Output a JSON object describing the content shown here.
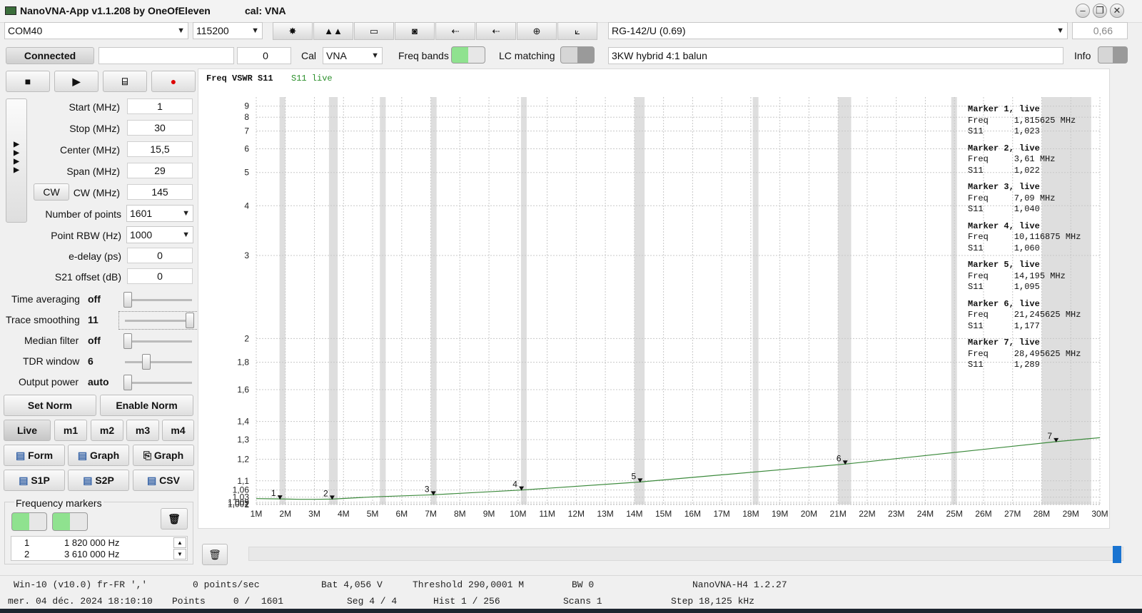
{
  "window": {
    "title": "NanoVNA-App v1.1.208 by OneOfEleven",
    "cal": "cal: VNA",
    "btn_min": "–",
    "btn_max": "❐",
    "btn_close": "✕"
  },
  "toolbar": {
    "port": "COM40",
    "baud": "115200",
    "cable": "RG-142/U (0.69)",
    "velocity": "0,66",
    "icons": [
      "settings-icon",
      "signal-icon",
      "battery-icon",
      "camera-icon",
      "usb-icon",
      "usb-plug-icon",
      "smith-chart-icon",
      "graph-icon"
    ]
  },
  "row2": {
    "connected": "Connected",
    "progress_value": "0",
    "cal_label": "Cal",
    "cal_value": "VNA",
    "freq_bands": "Freq bands",
    "lc_matching": "LC matching",
    "note": "3KW hybrid 4:1 balun",
    "info": "Info"
  },
  "controls": {
    "start_label": "Start (MHz)",
    "start": "1",
    "stop_label": "Stop (MHz)",
    "stop": "30",
    "center_label": "Center (MHz)",
    "center": "15,5",
    "span_label": "Span (MHz)",
    "span": "29",
    "cw_button": "CW",
    "cw_label": "CW (MHz)",
    "cw": "145",
    "points_label": "Number of points",
    "points": "1601",
    "rbw_label": "Point RBW (Hz)",
    "rbw": "1000",
    "edelay_label": "e-delay (ps)",
    "edelay": "0",
    "s21_label": "S21 offset (dB)",
    "s21": "0",
    "avg_label": "Time averaging",
    "avg": "off",
    "smooth_label": "Trace smoothing",
    "smooth": "11",
    "median_label": "Median filter",
    "median": "off",
    "tdr_label": "TDR window",
    "tdr": "6",
    "power_label": "Output power",
    "power": "auto",
    "set_norm": "Set Norm",
    "enable_norm": "Enable Norm",
    "live": "Live",
    "m1": "m1",
    "m2": "m2",
    "m3": "m3",
    "m4": "m4",
    "form": "Form",
    "graph1": "Graph",
    "graph2": "Graph",
    "s1p": "S1P",
    "s2p": "S2P",
    "csv": "CSV",
    "freq_markers": "Frequency markers",
    "marker_rows": [
      {
        "idx": "1",
        "freq": "1 820 000 Hz"
      },
      {
        "idx": "2",
        "freq": "3 610 000 Hz"
      }
    ]
  },
  "chart_header": {
    "title": "Freq VSWR S11",
    "live": "S11 live"
  },
  "chart_data": {
    "type": "line",
    "xlabel": "",
    "ylabel": "",
    "xlim": [
      1,
      30
    ],
    "ylim": [
      1,
      10
    ],
    "yscale": "vswr",
    "grid": true,
    "x_ticks": [
      "1M",
      "2M",
      "3M",
      "4M",
      "5M",
      "6M",
      "7M",
      "8M",
      "9M",
      "10M",
      "11M",
      "12M",
      "13M",
      "14M",
      "15M",
      "16M",
      "17M",
      "18M",
      "19M",
      "20M",
      "21M",
      "22M",
      "23M",
      "24M",
      "25M",
      "26M",
      "27M",
      "28M",
      "29M",
      "30M"
    ],
    "y_ticks": [
      {
        "v": 1,
        "label": "1"
      },
      {
        "v": 1.002,
        "label": "1,002"
      },
      {
        "v": 1.009,
        "label": "1,009"
      },
      {
        "v": 1.03,
        "label": "1,03"
      },
      {
        "v": 1.06,
        "label": "1,06"
      },
      {
        "v": 1.1,
        "label": "1,1"
      },
      {
        "v": 1.2,
        "label": "1,2"
      },
      {
        "v": 1.3,
        "label": "1,3"
      },
      {
        "v": 1.4,
        "label": "1,4"
      },
      {
        "v": 1.6,
        "label": "1,6"
      },
      {
        "v": 1.8,
        "label": "1,8"
      },
      {
        "v": 2,
        "label": "2"
      },
      {
        "v": 3,
        "label": "3"
      },
      {
        "v": 4,
        "label": "4"
      },
      {
        "v": 5,
        "label": "5"
      },
      {
        "v": 6,
        "label": "6"
      },
      {
        "v": 7,
        "label": "7"
      },
      {
        "v": 8,
        "label": "8"
      },
      {
        "v": 9,
        "label": "9"
      }
    ],
    "bands_mhz": [
      [
        1.8,
        2.0
      ],
      [
        3.5,
        3.8
      ],
      [
        5.25,
        5.45
      ],
      [
        7.0,
        7.2
      ],
      [
        10.1,
        10.15
      ],
      [
        14.0,
        14.35
      ],
      [
        18.068,
        18.168
      ],
      [
        21.0,
        21.45
      ],
      [
        24.89,
        24.99
      ],
      [
        28.0,
        29.7
      ]
    ],
    "series": [
      {
        "color": "#3c8a3c",
        "x": [
          1,
          1.815625,
          2.5,
          3.0,
          3.61,
          5,
          7.09,
          10.116875,
          14.195,
          21.245625,
          28.495625,
          30
        ],
        "y": [
          1.024,
          1.023,
          1.021,
          1.021,
          1.022,
          1.031,
          1.04,
          1.06,
          1.095,
          1.177,
          1.289,
          1.31
        ]
      }
    ],
    "markers": [
      {
        "n": "1",
        "x": 1.815625,
        "y": 1.023
      },
      {
        "n": "2",
        "x": 3.61,
        "y": 1.022
      },
      {
        "n": "3",
        "x": 7.09,
        "y": 1.04
      },
      {
        "n": "4",
        "x": 10.116875,
        "y": 1.06
      },
      {
        "n": "5",
        "x": 14.195,
        "y": 1.095
      },
      {
        "n": "6",
        "x": 21.245625,
        "y": 1.177
      },
      {
        "n": "7",
        "x": 28.495625,
        "y": 1.289
      }
    ],
    "marker_info": [
      {
        "title": "Marker 1, live",
        "freq": "1,815625 MHz",
        "s11": "1,023"
      },
      {
        "title": "Marker 2, live",
        "freq": "3,61 MHz",
        "s11": "1,022"
      },
      {
        "title": "Marker 3, live",
        "freq": "7,09 MHz",
        "s11": "1,040"
      },
      {
        "title": "Marker 4, live",
        "freq": "10,116875 MHz",
        "s11": "1,060"
      },
      {
        "title": "Marker 5, live",
        "freq": "14,195 MHz",
        "s11": "1,095"
      },
      {
        "title": "Marker 6, live",
        "freq": "21,245625 MHz",
        "s11": "1,177"
      },
      {
        "title": "Marker 7, live",
        "freq": "28,495625 MHz",
        "s11": "1,289"
      }
    ],
    "freq_label": "Freq",
    "s11_label": "S11"
  },
  "status": {
    "os": "Win-10 (v10.0) fr-FR ','",
    "rate": "0 points/sec",
    "bat": "Bat 4,056 V",
    "threshold": "Threshold 290,0001 M",
    "bw": "BW 0",
    "device": "NanoVNA-H4 1.2.27",
    "datetime": "mer. 04 déc. 2024 18:10:10",
    "points": "Points     0 /  1601",
    "seg": "Seg 4 / 4",
    "hist": "Hist 1 / 256",
    "scans": "Scans 1",
    "step": "Step 18,125 kHz"
  }
}
